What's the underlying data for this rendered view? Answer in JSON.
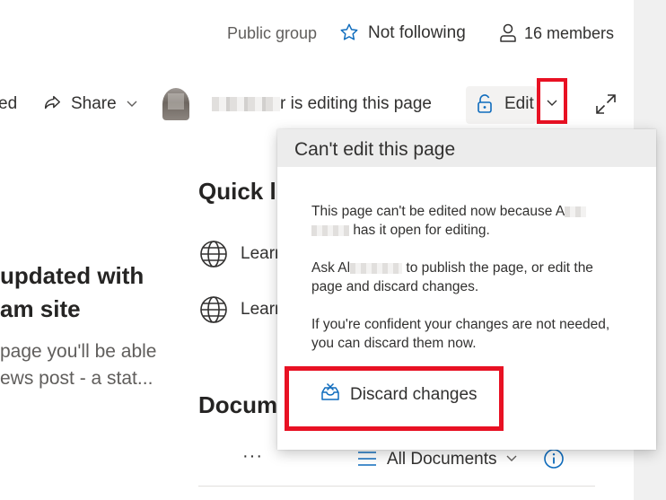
{
  "header": {
    "group_type": "Public group",
    "follow_label": "Not following",
    "members_label": "16 members"
  },
  "command_bar": {
    "truncated_fragment": "ed",
    "share_label": "Share",
    "editing_status": "r is editing this page",
    "edit_label": "Edit"
  },
  "quick_links": {
    "title": "Quick li",
    "items": [
      {
        "label": "Learn",
        "icon": "globe-icon"
      },
      {
        "label": "Learn",
        "icon": "globe-icon"
      }
    ]
  },
  "news": {
    "title_line1": "updated with",
    "title_line2": "am site",
    "body_line1": "page you'll be able",
    "body_line2": "ews post - a stat..."
  },
  "documents": {
    "title": "Docum",
    "more_label": "···",
    "view_label": "All Documents"
  },
  "callout": {
    "title": "Can't edit this page",
    "p1_line1": "This page can't be edited now because A",
    "p1_line2": "has it open for editing.",
    "p2_line1_start": "Ask Al",
    "p2_line1_end": "to publish the page, or edit the",
    "p2_line2": "page and discard changes.",
    "p3_line1": "If you're confident your changes are not needed,",
    "p3_line2": "you can discard them now.",
    "discard_label": "Discard changes"
  },
  "colors": {
    "highlight": "#e81123",
    "icon_blue": "#0f6cbd",
    "header_gray": "#ececec"
  }
}
